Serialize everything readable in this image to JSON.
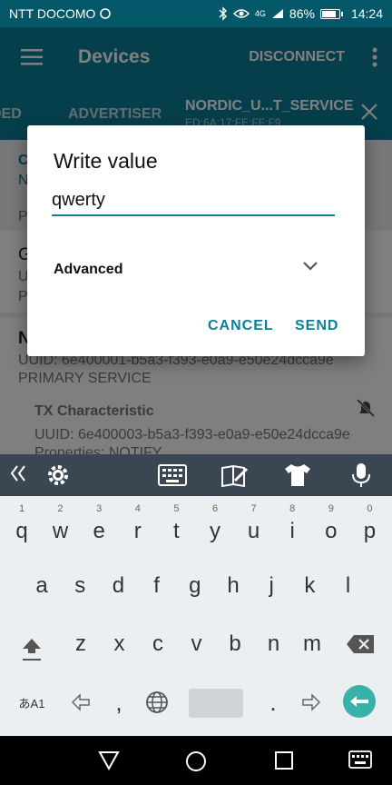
{
  "status": {
    "carrier": "NTT DOCOMO",
    "network": "4G",
    "battery": "86%",
    "battery_level": 0.86,
    "time": "14:24"
  },
  "app_bar": {
    "title": "Devices",
    "disconnect": "DISCONNECT"
  },
  "tabs": {
    "left_partial": "DED",
    "advertiser": "ADVERTISER",
    "active": "NORDIC_U...T_SERVICE",
    "active_sub": "ED:6A:17:FE:FF:F9"
  },
  "content": {
    "partial_row1": "C",
    "partial_row2": "N",
    "partial_row3": "P",
    "partial_row4": "G",
    "partial_row5": "UUID",
    "partial_row6": "P",
    "partial_row7": "N",
    "service_uuid": "UUID: 6e400001-b5a3-f393-e0a9-e50e24dcca9e",
    "service_type": "PRIMARY SERVICE",
    "char_title": "TX Characteristic",
    "char_uuid": "UUID: 6e400003-b5a3-f393-e0a9-e50e24dcca9e",
    "char_props": "Properties: NOTIFY"
  },
  "dialog": {
    "title": "Write value",
    "value": "qwerty",
    "advanced": "Advanced",
    "cancel": "CANCEL",
    "send": "SEND"
  },
  "keyboard": {
    "row1": [
      [
        "q",
        "1"
      ],
      [
        "w",
        "2"
      ],
      [
        "e",
        "3"
      ],
      [
        "r",
        "4"
      ],
      [
        "t",
        "5"
      ],
      [
        "y",
        "6"
      ],
      [
        "u",
        "7"
      ],
      [
        "i",
        "8"
      ],
      [
        "o",
        "9"
      ],
      [
        "p",
        "0"
      ]
    ],
    "row2": [
      "a",
      "s",
      "d",
      "f",
      "g",
      "h",
      "j",
      "k",
      "l"
    ],
    "row3": [
      "z",
      "x",
      "c",
      "v",
      "b",
      "n",
      "m"
    ],
    "mode": "あA1",
    "comma": ",",
    "period": "."
  },
  "colors": {
    "primary": "#0c7f99",
    "status_bar": "#04586a",
    "enter": "#38b2a8"
  }
}
